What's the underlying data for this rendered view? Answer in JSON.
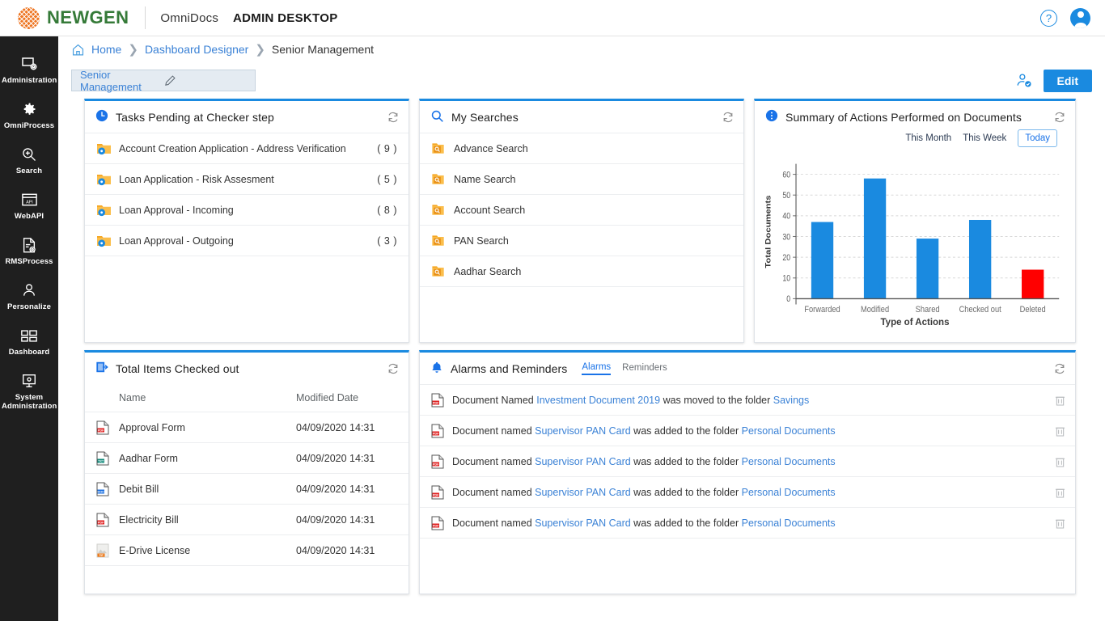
{
  "header": {
    "brand": "NEWGEN",
    "app_name": "OmniDocs",
    "app_mode": "ADMIN DESKTOP",
    "help_icon": "help-circle-icon",
    "avatar_icon": "user-avatar-icon"
  },
  "sidebar": {
    "items": [
      {
        "label": "Administration",
        "icon": "monitor-settings-icon"
      },
      {
        "label": "OmniProcess",
        "icon": "gear-icon"
      },
      {
        "label": "Search",
        "icon": "magnifier-plus-icon"
      },
      {
        "label": "WebAPI",
        "icon": "api-window-icon"
      },
      {
        "label": "RMSProcess",
        "icon": "document-gear-icon"
      },
      {
        "label": "Personalize",
        "icon": "person-icon"
      },
      {
        "label": "Dashboard",
        "icon": "grid-tiles-icon"
      },
      {
        "label": "System Administration",
        "icon": "system-monitor-icon"
      }
    ]
  },
  "breadcrumb": {
    "home_icon": "home-icon",
    "items": [
      "Home",
      "Dashboard Designer",
      "Senior Management"
    ]
  },
  "toolbar": {
    "title_value": "Senior Management",
    "title_placeholder": "Dashboard name",
    "pencil_icon": "pencil-edit-icon",
    "share_icon": "user-check-icon",
    "edit_label": "Edit"
  },
  "panels": {
    "tasks": {
      "title": "Tasks Pending at Checker step",
      "icon": "clock-icon",
      "refresh_icon": "refresh-icon",
      "rows": [
        {
          "label": "Account Creation Application - Address Verification",
          "count": "( 9 )",
          "icon": "folder-process-icon"
        },
        {
          "label": "Loan Application - Risk Assesment",
          "count": "( 5 )",
          "icon": "folder-process-icon"
        },
        {
          "label": "Loan Approval - Incoming",
          "count": "( 8 )",
          "icon": "folder-process-icon"
        },
        {
          "label": "Loan Approval - Outgoing",
          "count": "( 3 )",
          "icon": "folder-process-icon"
        }
      ]
    },
    "searches": {
      "title": "My Searches",
      "icon": "search-icon",
      "refresh_icon": "refresh-icon",
      "rows": [
        {
          "label": "Advance Search",
          "icon": "folder-search-icon"
        },
        {
          "label": "Name Search",
          "icon": "folder-search-icon"
        },
        {
          "label": "Account Search",
          "icon": "folder-search-icon"
        },
        {
          "label": "PAN Search",
          "icon": "folder-search-icon"
        },
        {
          "label": "Aadhar Search",
          "icon": "folder-search-icon"
        }
      ]
    },
    "summary": {
      "title": "Summary of Actions Performed on Documents",
      "icon": "info-dots-icon",
      "refresh_icon": "refresh-icon",
      "filters": [
        {
          "label": "This Month",
          "active": false
        },
        {
          "label": "This Week",
          "active": false
        },
        {
          "label": "Today",
          "active": true
        }
      ]
    },
    "checkedout": {
      "title": "Total Items Checked out",
      "icon": "checkout-document-icon",
      "refresh_icon": "refresh-icon",
      "columns": {
        "name": "Name",
        "date": "Modified Date"
      },
      "rows": [
        {
          "name": "Approval Form",
          "date": "04/09/2020 14:31",
          "icon": "pdf-file-icon",
          "type": "PDF"
        },
        {
          "name": "Aadhar Form",
          "date": "04/09/2020 14:31",
          "icon": "txt-file-icon",
          "type": "TXT"
        },
        {
          "name": "Debit Bill",
          "date": "04/09/2020 14:31",
          "icon": "doc-file-icon",
          "type": "DOC"
        },
        {
          "name": "Electricity Bill",
          "date": "04/09/2020 14:31",
          "icon": "pdf-file-icon",
          "type": "PDF"
        },
        {
          "name": "E-Drive License",
          "date": "04/09/2020 14:31",
          "icon": "tif-file-icon",
          "type": "TIF"
        }
      ]
    },
    "alarms": {
      "title": "Alarms and Reminders",
      "icon": "bell-icon",
      "refresh_icon": "refresh-icon",
      "tabs": [
        {
          "label": "Alarms",
          "active": true
        },
        {
          "label": "Reminders",
          "active": false
        }
      ],
      "rows": [
        {
          "icon": "pdf-file-icon",
          "pre": "Document Named ",
          "link1": "Investment Document 2019",
          "mid": " was moved to the folder ",
          "link2": "Savings",
          "delete_icon": "trash-icon"
        },
        {
          "icon": "pdf-file-icon",
          "pre": "Document named ",
          "link1": "Supervisor PAN Card",
          "mid": " was added to the folder ",
          "link2": "Personal Documents",
          "delete_icon": "trash-icon"
        },
        {
          "icon": "pdf-file-icon",
          "pre": "Document named ",
          "link1": "Supervisor PAN Card",
          "mid": " was added to the folder ",
          "link2": "Personal Documents",
          "delete_icon": "trash-icon"
        },
        {
          "icon": "pdf-file-icon",
          "pre": "Document named ",
          "link1": "Supervisor PAN Card",
          "mid": " was added to the folder ",
          "link2": "Personal Documents",
          "delete_icon": "trash-icon"
        },
        {
          "icon": "pdf-file-icon",
          "pre": "Document named ",
          "link1": "Supervisor PAN Card",
          "mid": " was added to the folder ",
          "link2": "Personal Documents",
          "delete_icon": "trash-icon"
        }
      ]
    }
  },
  "chart_data": {
    "type": "bar",
    "title": "Summary of Actions Performed on Documents",
    "categories": [
      "Forwarded",
      "Modified",
      "Shared",
      "Checked out",
      "Deleted"
    ],
    "values": [
      37,
      58,
      29,
      38,
      14
    ],
    "colors": [
      "#1a8ae0",
      "#1a8ae0",
      "#1a8ae0",
      "#1a8ae0",
      "#ff0000"
    ],
    "xlabel": "Type of Actions",
    "ylabel": "Total Documents",
    "ylim": [
      0,
      60
    ],
    "yticks": [
      0,
      10,
      20,
      30,
      40,
      50,
      60
    ],
    "grid": true,
    "legend": "none"
  },
  "colors": {
    "accent": "#1a8ae0",
    "brand_green": "#357a38",
    "brand_orange": "#ee7623",
    "link": "#3b82d6",
    "danger": "#ff0000",
    "sidebar_bg": "#1f1f1f"
  }
}
